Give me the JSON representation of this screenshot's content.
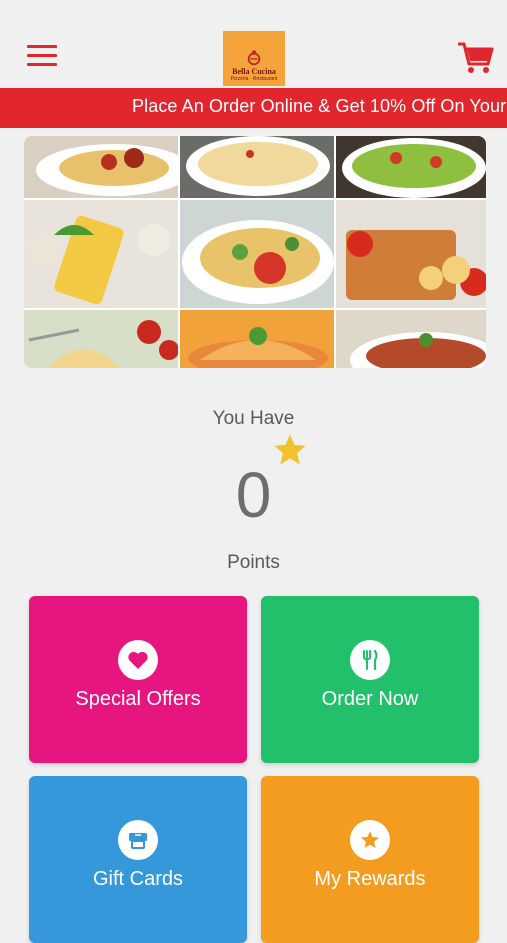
{
  "header": {
    "logo": {
      "name": "Bella Cucina",
      "tagline": "Pizzeria · Restaurant"
    }
  },
  "banner": {
    "text": "Place An Order Online & Get 10% Off On Your"
  },
  "points": {
    "label_top": "You Have",
    "value": "0",
    "label_bottom": "Points"
  },
  "actions": [
    {
      "label": "Special Offers",
      "color": "#e6157f",
      "icon": "heart-icon"
    },
    {
      "label": "Order Now",
      "color": "#22c06a",
      "icon": "fork-knife-icon"
    },
    {
      "label": "Gift Cards",
      "color": "#3498db",
      "icon": "gift-card-icon"
    },
    {
      "label": "My Rewards",
      "color": "#f39c1f",
      "icon": "star-icon"
    }
  ],
  "colors": {
    "brand": "#e2262e",
    "star": "#f2c12e"
  }
}
